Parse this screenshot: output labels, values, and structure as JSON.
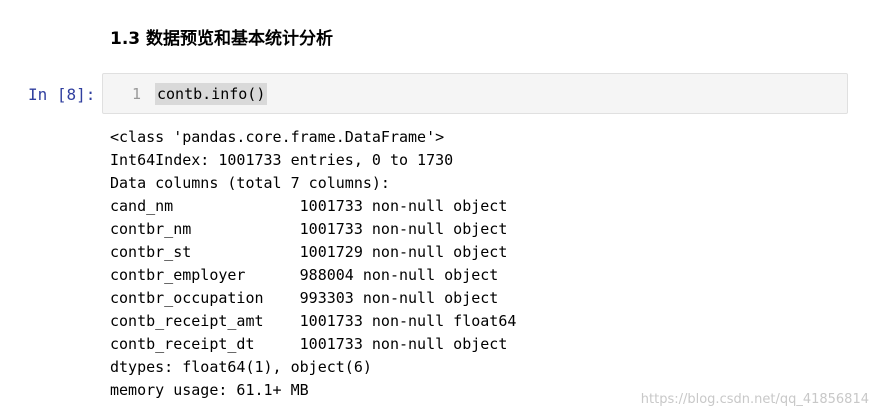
{
  "notebook": {
    "heading": "1.3 数据预览和基本统计分析",
    "cell": {
      "prompt": "In [8]:",
      "line_number": "1",
      "code": "contb.info()"
    },
    "output_lines": [
      "<class 'pandas.core.frame.DataFrame'>",
      "Int64Index: 1001733 entries, 0 to 1730",
      "Data columns (total 7 columns):",
      "cand_nm              1001733 non-null object",
      "contbr_nm            1001733 non-null object",
      "contbr_st            1001729 non-null object",
      "contbr_employer      988004 non-null object",
      "contbr_occupation    993303 non-null object",
      "contb_receipt_amt    1001733 non-null float64",
      "contb_receipt_dt     1001733 non-null object",
      "dtypes: float64(1), object(6)",
      "memory usage: 61.1+ MB"
    ]
  },
  "watermark": "https://blog.csdn.net/qq_41856814",
  "colors": {
    "prompt": "#303f9f",
    "cell_background": "#f5f5f5",
    "cell_border": "#e0e0e0",
    "code_highlight": "#d9d9d9"
  }
}
